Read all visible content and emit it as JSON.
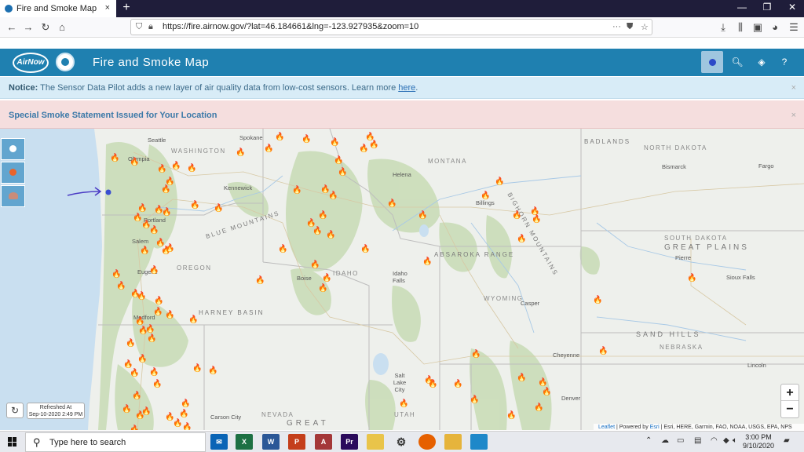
{
  "browser": {
    "tab_title": "Fire and Smoke Map",
    "tab_close": "×",
    "new_tab": "+",
    "url": "https://fire.airnow.gov/?lat=46.184661&lng=-123.927935&zoom=10",
    "url_more": "···"
  },
  "header": {
    "logo_text": "AirNow",
    "title": "Fire and Smoke Map"
  },
  "notice": {
    "prefix": "Notice:",
    "text": " The Sensor Data Pilot adds a new layer of air quality data from low-cost sensors. Learn more ",
    "link": "here",
    "suffix": ".",
    "close": "×"
  },
  "alert": {
    "text": "Special Smoke Statement Issued for Your Location",
    "close": "×"
  },
  "map": {
    "cities": [
      {
        "name": "Seattle"
      },
      {
        "name": "Olympia"
      },
      {
        "name": "Spokane"
      },
      {
        "name": "Kennewick"
      },
      {
        "name": "Portland"
      },
      {
        "name": "Salem"
      },
      {
        "name": "Eugene"
      },
      {
        "name": "Medford"
      },
      {
        "name": "Helena"
      },
      {
        "name": "Billings"
      },
      {
        "name": "Bismarck"
      },
      {
        "name": "Fargo"
      },
      {
        "name": "Pierre"
      },
      {
        "name": "Sioux Falls"
      },
      {
        "name": "Boise"
      },
      {
        "name": "Idaho Falls"
      },
      {
        "name": "Casper"
      },
      {
        "name": "Cheyenne"
      },
      {
        "name": "Lincoln"
      },
      {
        "name": "Salt Lake City"
      },
      {
        "name": "Denver"
      },
      {
        "name": "Carson City"
      }
    ],
    "states": [
      {
        "name": "WASHINGTON"
      },
      {
        "name": "OREGON"
      },
      {
        "name": "IDAHO"
      },
      {
        "name": "MONTANA"
      },
      {
        "name": "NORTH DAKOTA"
      },
      {
        "name": "SOUTH DAKOTA"
      },
      {
        "name": "WYOMING"
      },
      {
        "name": "NEBRASKA"
      },
      {
        "name": "NEVADA"
      },
      {
        "name": "UTAH"
      }
    ],
    "regions": [
      {
        "name": "BADLANDS"
      },
      {
        "name": "GREAT PLAINS"
      },
      {
        "name": "BLUE MOUNTAINS"
      },
      {
        "name": "HARNEY BASIN"
      },
      {
        "name": "SAND HILLS"
      },
      {
        "name": "ABSAROKA RANGE"
      },
      {
        "name": "BIGHORN MOUNTAINS"
      },
      {
        "name": "GREAT"
      }
    ],
    "fire_glyph": "🔥",
    "colors": {
      "fire": "#e0461a",
      "location_dot": "#3a4fd1",
      "arrow": "#4a3bc4",
      "water": "#c9dff0"
    }
  },
  "controls": {
    "zoom_in": "+",
    "zoom_out": "−",
    "refresh_icon": "↻",
    "refreshed_label": "Refreshed At",
    "refreshed_time": "Sep-10-2020 2:49 PM",
    "attribution_leaflet": "Leaflet",
    "attribution_powered": " | Powered by ",
    "attribution_esri": "Esri",
    "attribution_rest": " | Esri, HERE, Garmin, FAO, NOAA, USGS, EPA, NPS"
  },
  "taskbar": {
    "search_placeholder": "Type here to search",
    "time": "3:00 PM",
    "date": "9/10/2020"
  }
}
